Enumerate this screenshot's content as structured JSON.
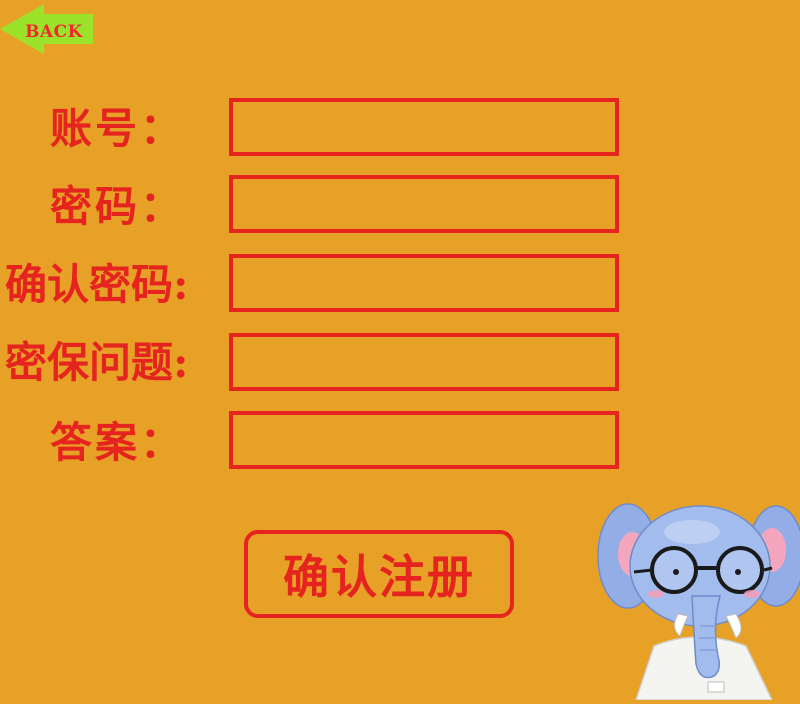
{
  "back_button": {
    "label": "BACK",
    "icon": "arrow-left-icon",
    "color": "#9BE22B"
  },
  "form": {
    "fields": [
      {
        "label": "账号："
      },
      {
        "label": "密码："
      },
      {
        "label": "确认密码:"
      },
      {
        "label": "密保问题:"
      },
      {
        "label": "答案："
      }
    ],
    "submit_label": "确认注册"
  },
  "mascot": {
    "icon": "elephant-with-glasses-icon"
  },
  "colors": {
    "background": "#E8A127",
    "accent": "#E5231F",
    "back_arrow": "#9BE22B"
  }
}
